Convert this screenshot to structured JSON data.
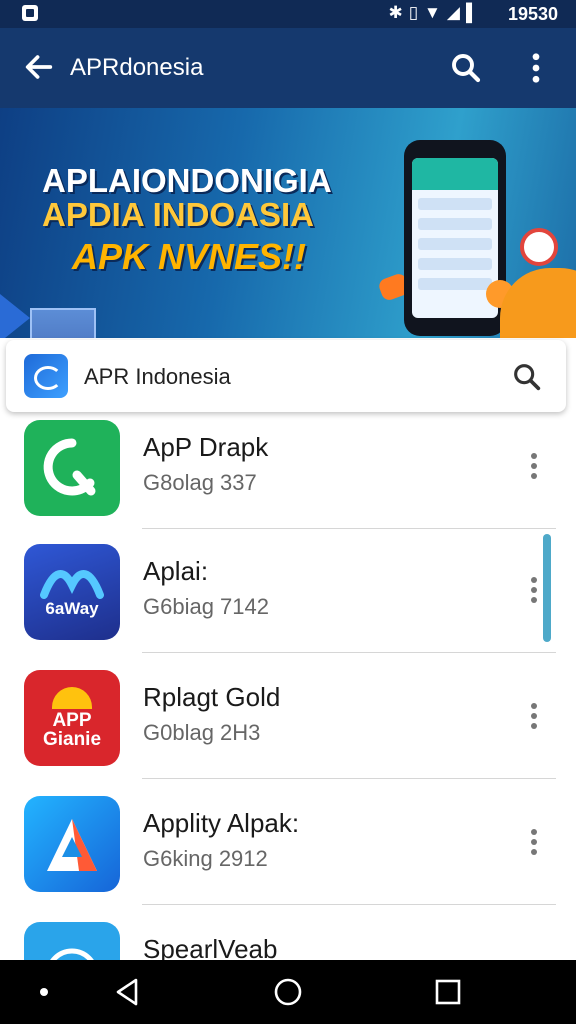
{
  "status_bar": {
    "time": "19530",
    "icons": [
      "bluetooth-icon",
      "vibrate-icon",
      "wifi-icon",
      "signal-icon",
      "battery-icon"
    ]
  },
  "app_bar": {
    "title": "APRdonesia"
  },
  "banner": {
    "line1": "APLAIONDONIGIA",
    "line2": "APDIA INDOASIA",
    "line3": "APK NVNES!!"
  },
  "search_card": {
    "label": "APR Indonesia"
  },
  "apps": [
    {
      "name": "ApP Drapk",
      "subtitle": "G8olag 337",
      "icon_color": "#1fb25a",
      "icon_text": ""
    },
    {
      "name": "Aplai:",
      "subtitle": "G6biag 7142",
      "icon_color": "#2a4cc0",
      "icon_text": "6aWay"
    },
    {
      "name": "Rplagt Gold",
      "subtitle": "G0blag 2H3",
      "icon_color": "#d9262c",
      "icon_text": "APP Gianie"
    },
    {
      "name": "Applity Alpak:",
      "subtitle": "G6king 2912",
      "icon_color": "#1c8fe6",
      "icon_text": ""
    },
    {
      "name": "SpearlVeab",
      "subtitle": "",
      "icon_color": "#2aa4ea",
      "icon_text": ""
    }
  ],
  "colors": {
    "status_bar": "#102a55",
    "app_bar": "#15396e",
    "scrollbar": "#4ea9c9"
  }
}
